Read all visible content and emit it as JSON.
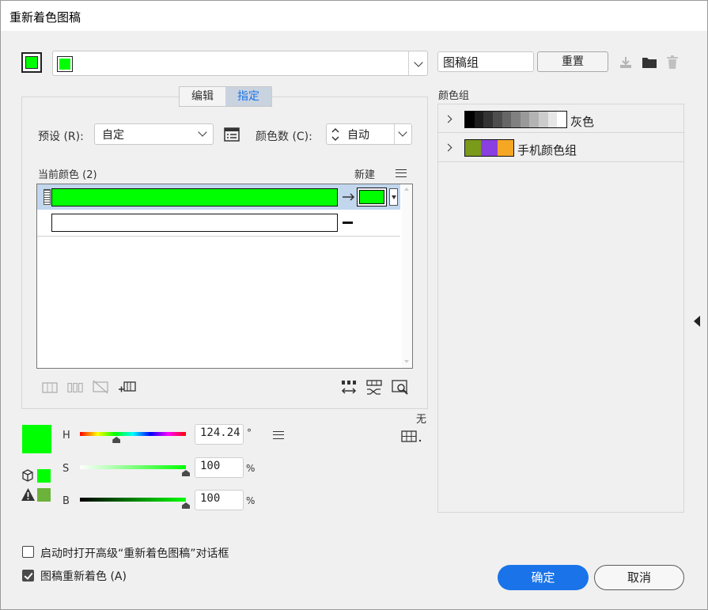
{
  "window": {
    "title": "重新着色图稿"
  },
  "colors": {
    "green": "#00ff00",
    "accent": "#1a73e8",
    "dark_green": "#6bb33a"
  },
  "top": {
    "group_name_value": "图稿组",
    "reset_label": "重置",
    "icons": [
      "save-to-swatches-icon",
      "folder-icon",
      "trash-icon"
    ]
  },
  "tabs": [
    {
      "label": "编辑",
      "active": false
    },
    {
      "label": "指定",
      "active": true
    }
  ],
  "assign": {
    "preset_label": "预设 (R):",
    "preset_value": "自定",
    "color_count_label": "颜色数 (C):",
    "color_count_value": "自动",
    "current_colors_label": "当前颜色 (2)",
    "new_label": "新建"
  },
  "color_groups": {
    "header": "颜色组",
    "items": [
      {
        "name": "灰色",
        "swatches": [
          "#000000",
          "#1c1c1c",
          "#333333",
          "#4d4d4d",
          "#666666",
          "#808080",
          "#999999",
          "#b3b3b3",
          "#cccccc",
          "#e6e6e6",
          "#ffffff"
        ]
      },
      {
        "name": "手机颜色组",
        "swatches": [
          "#7a9a1a",
          "#8a3fe0",
          "#f5a623"
        ]
      }
    ]
  },
  "hsb": {
    "h_label": "H",
    "h_value": "124.24",
    "h_unit": "°",
    "s_label": "S",
    "s_value": "100",
    "s_unit": "%",
    "b_label": "B",
    "b_value": "100",
    "b_unit": "%",
    "h_fraction": 0.345,
    "s_fraction": 1.0,
    "b_fraction": 1.0,
    "none_label": "无"
  },
  "footer": {
    "checkbox1_label": "启动时打开高级“重新着色图稿”对话框",
    "checkbox1_checked": false,
    "checkbox2_label": "图稿重新着色 (A)",
    "checkbox2_checked": true,
    "ok_label": "确定",
    "cancel_label": "取消"
  }
}
